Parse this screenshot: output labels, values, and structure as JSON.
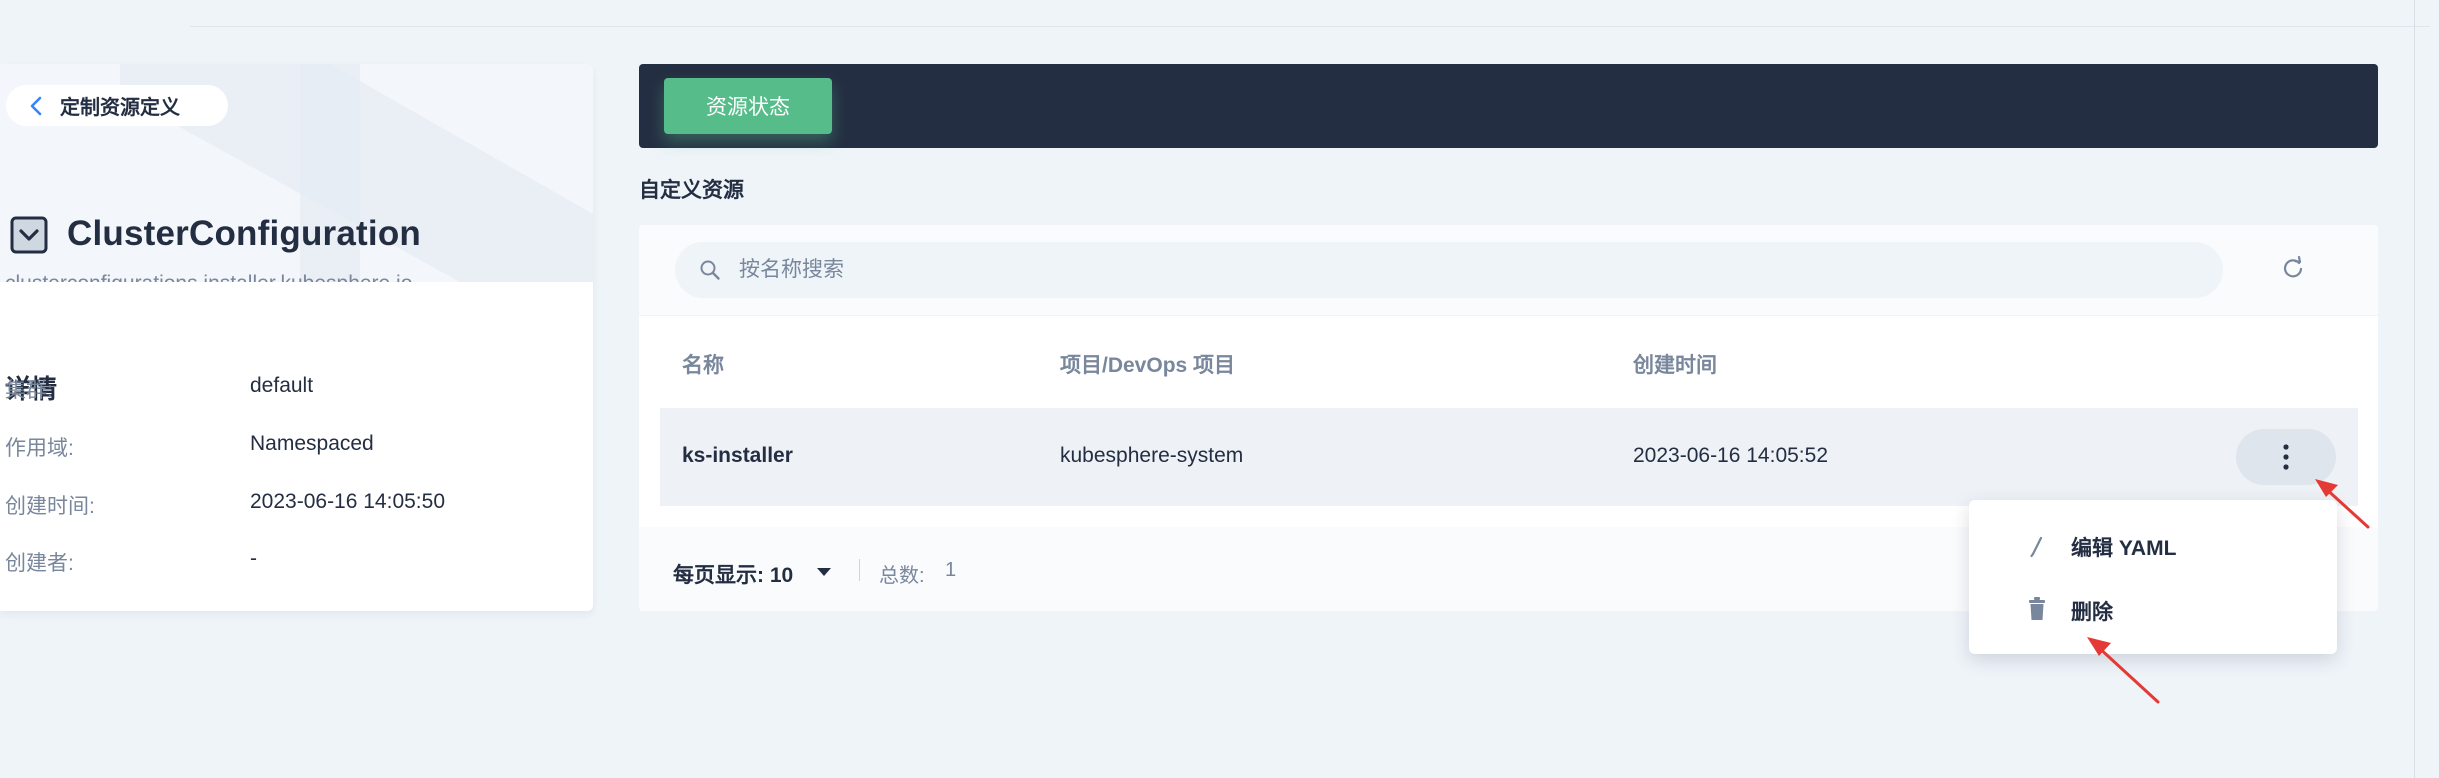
{
  "colors": {
    "brand_green": "#55bc8a",
    "banner_dark": "#242e42",
    "text_primary": "#242e42",
    "text_secondary": "#79879c",
    "annotation_red": "#e53935"
  },
  "sidebar": {
    "back_label": "定制资源定义",
    "resource_icon": "crd-icon",
    "title": "ClusterConfiguration",
    "subtitle": "clusterconfigurations.installer.kubesphere.io",
    "details_title": "详情",
    "details": [
      {
        "key": "集群:",
        "value": "default"
      },
      {
        "key": "作用域:",
        "value": "Namespaced"
      },
      {
        "key": "创建时间:",
        "value": "2023-06-16 14:05:50"
      },
      {
        "key": "创建者:",
        "value": "-"
      }
    ]
  },
  "main": {
    "tab_label": "资源状态",
    "section_title": "自定义资源",
    "search_placeholder": "按名称搜索",
    "columns": [
      "名称",
      "项目/DevOps 项目",
      "创建时间"
    ],
    "rows": [
      {
        "name": "ks-installer",
        "project": "kubesphere-system",
        "created": "2023-06-16 14:05:52"
      }
    ],
    "footer": {
      "per_page_label": "每页显示:",
      "per_page_value": "10",
      "total_label": "总数:",
      "total_value": "1"
    }
  },
  "menu": {
    "items": [
      {
        "label": "编辑 YAML",
        "icon": "pencil-icon"
      },
      {
        "label": "删除",
        "icon": "trash-icon"
      }
    ]
  }
}
